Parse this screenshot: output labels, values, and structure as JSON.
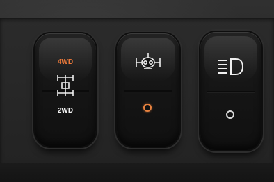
{
  "switches": [
    {
      "top_label": "4WD",
      "bottom_label": "2WD",
      "top_label_color": "#ef7a3a",
      "bottom_label_color": "#f2f2f2",
      "icon": "drivetrain-4wd-2wd-icon"
    },
    {
      "icon": "differential-lock-icon",
      "indicator_color": "#e8823f"
    },
    {
      "icon": "headlight-icon",
      "indicator_color": "#d9d9d9"
    }
  ]
}
